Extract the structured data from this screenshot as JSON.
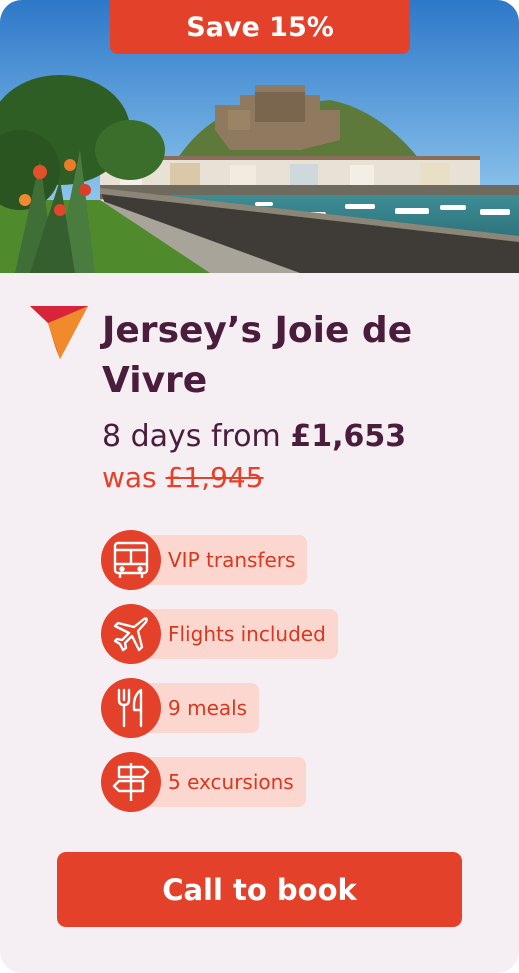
{
  "badge": "Save 15%",
  "title": "Jersey’s Joie de Vivre",
  "price": {
    "prefix": "8 days from",
    "amount": "£1,653",
    "was_label": "was",
    "was_amount": "£1,945"
  },
  "features": [
    {
      "icon": "bus-icon",
      "label": "VIP transfers"
    },
    {
      "icon": "airplane-icon",
      "label": "Flights included"
    },
    {
      "icon": "cutlery-icon",
      "label": "9 meals"
    },
    {
      "icon": "signpost-icon",
      "label": "5 excursions"
    }
  ],
  "cta": "Call to book",
  "colors": {
    "accent": "#e3412a",
    "title": "#4a1d3c",
    "pill": "#fbd7d0",
    "card": "#f5eef2"
  }
}
